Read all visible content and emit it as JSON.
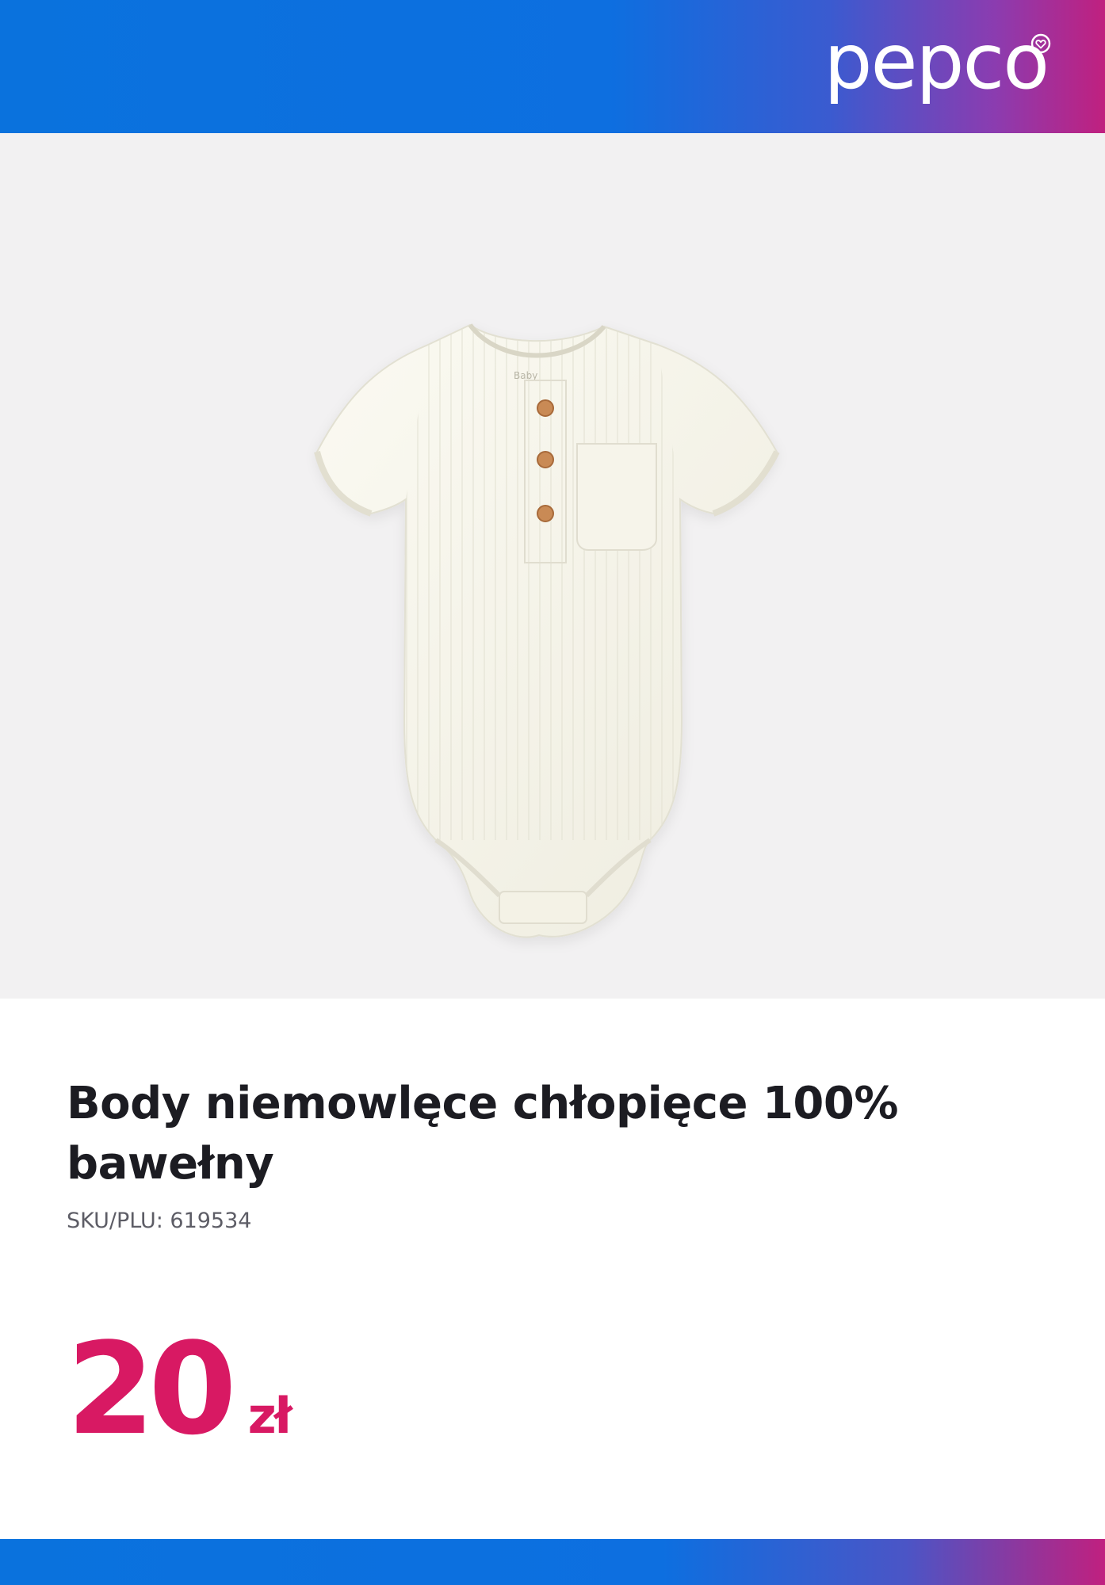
{
  "header": {
    "brand": "pepco"
  },
  "product": {
    "title": "Body niemowlęce chłopięce 100% bawełny",
    "sku": "SKU/PLU: 619534",
    "price_amount": "20",
    "price_currency": "zł",
    "image_alt": "body niemowlęce z krótkim rękawem, kolor ecru, z kieszonką i trzema guzikami"
  },
  "colors": {
    "brand_blue": "#0a72dd",
    "brand_magenta": "#c0207f",
    "price": "#d81963",
    "hero_bg": "#f2f1f2"
  }
}
